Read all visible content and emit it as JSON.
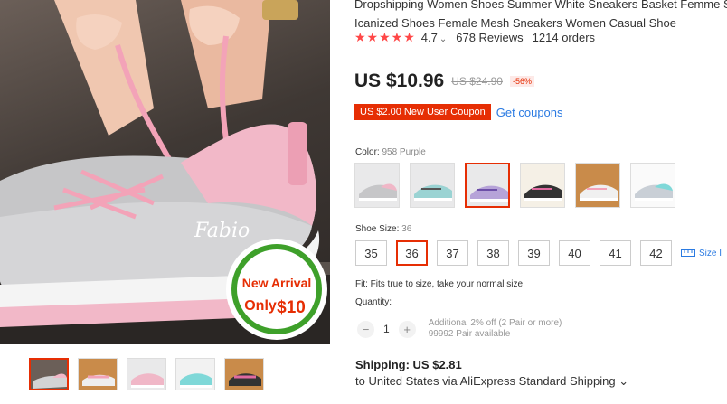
{
  "product": {
    "title_line1": "Dropshipping Women Shoes Summer White Sneakers Basket Femme Su",
    "title_line2": "Icanized Shoes Female Mesh Sneakers Women Casual Shoe",
    "rating": "4.7",
    "rating_caret": "⌄",
    "reviews": "678 Reviews",
    "orders": "1214 orders",
    "stars": "★★★★★"
  },
  "price": {
    "current": "US $10.96",
    "original": "US $24.90",
    "discount": "-56%"
  },
  "coupon": {
    "badge": "US $2.00 New User Coupon",
    "link": "Get coupons"
  },
  "color": {
    "label": "Color:",
    "selected": "958 Purple",
    "swatch_count": 6,
    "selected_index": 2
  },
  "size": {
    "label": "Shoe Size:",
    "selected": "36",
    "options": [
      "35",
      "36",
      "37",
      "38",
      "39",
      "40",
      "41",
      "42"
    ],
    "size_info": "Size I"
  },
  "fit": "Fit: Fits true to size, take your normal size",
  "quantity": {
    "label": "Quantity:",
    "value": "1",
    "minus": "−",
    "plus": "+",
    "note_line1": "Additional 2% off (2 Pair or more)",
    "note_line2": "99992 Pair available"
  },
  "shipping": {
    "cost": "Shipping: US $2.81",
    "route": "to United States via AliExpress Standard Shipping ⌄"
  },
  "main_image": {
    "badge_line1": "New Arrival",
    "badge_line2_a": "Only",
    "badge_line2_b": "$10",
    "shoe_brand": "Fabio"
  },
  "gallery": {
    "thumb_count": 5,
    "selected_index": 0
  },
  "colors": {
    "accent": "#e62e04",
    "star": "#ff4747",
    "link": "#2a7ae2",
    "badge_green": "#3ea02a"
  }
}
